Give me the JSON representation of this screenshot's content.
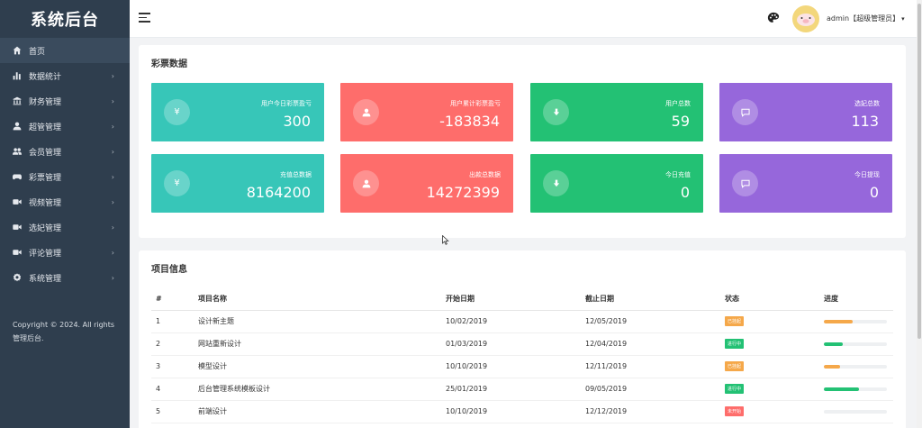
{
  "sidebar": {
    "brand": "系统后台",
    "items": [
      {
        "label": "首页",
        "icon": "home-icon",
        "has_arrow": false,
        "active": true
      },
      {
        "label": "数据统计",
        "icon": "bar-chart-icon",
        "has_arrow": true
      },
      {
        "label": "财务管理",
        "icon": "bank-icon",
        "has_arrow": true
      },
      {
        "label": "超管管理",
        "icon": "user-icon",
        "has_arrow": true
      },
      {
        "label": "会员管理",
        "icon": "users-icon",
        "has_arrow": true
      },
      {
        "label": "彩票管理",
        "icon": "gamepad-icon",
        "has_arrow": true
      },
      {
        "label": "视频管理",
        "icon": "video-icon",
        "has_arrow": true
      },
      {
        "label": "选妃管理",
        "icon": "video-icon",
        "has_arrow": true
      },
      {
        "label": "评论管理",
        "icon": "video-icon",
        "has_arrow": true
      },
      {
        "label": "系统管理",
        "icon": "gear-icon",
        "has_arrow": true
      }
    ],
    "arrow_glyph": "›",
    "copyright": "Copyright © 2024. All rights 管理后台."
  },
  "topbar": {
    "user_label": "admin【超级管理员】",
    "caret": "▾"
  },
  "stats": {
    "title": "彩票数据",
    "cards": [
      {
        "label": "用户今日彩票盈亏",
        "value": "300",
        "color": "#37c6b8",
        "icon": "yen-icon"
      },
      {
        "label": "用户累计彩票盈亏",
        "value": "-183834",
        "color": "#fe6d6b",
        "icon": "user-icon"
      },
      {
        "label": "用户总数",
        "value": "59",
        "color": "#23c174",
        "icon": "download-icon"
      },
      {
        "label": "选妃总数",
        "value": "113",
        "color": "#9667db",
        "icon": "comment-icon"
      },
      {
        "label": "充值总数据",
        "value": "8164200",
        "color": "#37c6b8",
        "icon": "yen-icon"
      },
      {
        "label": "出款总数据",
        "value": "14272399",
        "color": "#fe6d6b",
        "icon": "user-icon"
      },
      {
        "label": "今日充值",
        "value": "0",
        "color": "#23c174",
        "icon": "download-icon"
      },
      {
        "label": "今日提现",
        "value": "0",
        "color": "#9667db",
        "icon": "comment-icon"
      }
    ]
  },
  "projects": {
    "title": "项目信息",
    "columns": [
      "#",
      "项目名称",
      "开始日期",
      "截止日期",
      "状态",
      "进度"
    ],
    "rows": [
      {
        "id": "1",
        "name": "设计新主题",
        "start": "10/02/2019",
        "end": "12/05/2019",
        "status": "已挂起",
        "status_color": "#f5a84a",
        "progress": 0.45,
        "progress_color": "#f5a84a"
      },
      {
        "id": "2",
        "name": "网站重新设计",
        "start": "01/03/2019",
        "end": "12/04/2019",
        "status": "进行中",
        "status_color": "#23c174",
        "progress": 0.3,
        "progress_color": "#23c174"
      },
      {
        "id": "3",
        "name": "模型设计",
        "start": "10/10/2019",
        "end": "12/11/2019",
        "status": "已挂起",
        "status_color": "#f5a84a",
        "progress": 0.25,
        "progress_color": "#f5a84a"
      },
      {
        "id": "4",
        "name": "后台管理系统模板设计",
        "start": "25/01/2019",
        "end": "09/05/2019",
        "status": "进行中",
        "status_color": "#23c174",
        "progress": 0.55,
        "progress_color": "#23c174"
      },
      {
        "id": "5",
        "name": "前端设计",
        "start": "10/10/2019",
        "end": "12/12/2019",
        "status": "未开始",
        "status_color": "#fe6d6b",
        "progress": 0.0,
        "progress_color": "#fe6d6b"
      }
    ]
  }
}
